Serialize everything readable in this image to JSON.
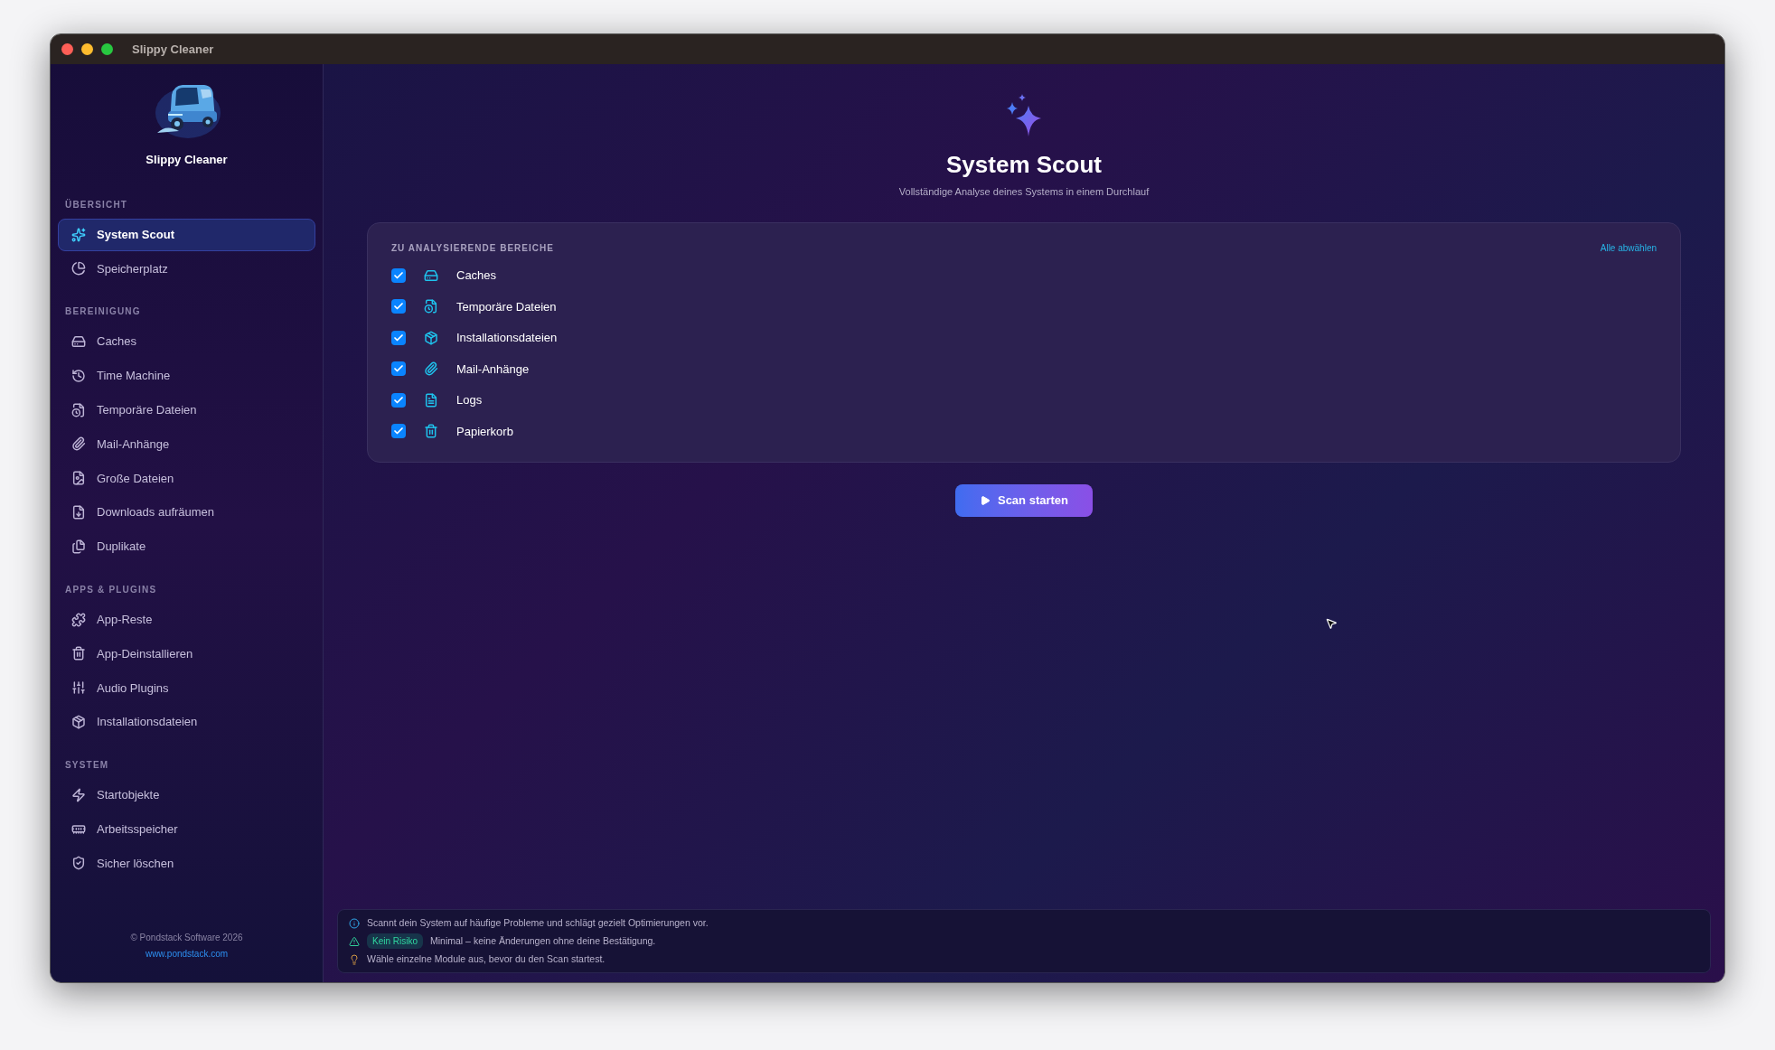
{
  "window": {
    "title": "Slippy Cleaner"
  },
  "sidebar": {
    "app_name": "Slippy Cleaner",
    "sections": [
      {
        "title": "ÜBERSICHT",
        "items": [
          {
            "label": "System Scout",
            "kind": "sparkles",
            "selected": true
          },
          {
            "label": "Speicherplatz",
            "kind": "pie",
            "selected": false
          }
        ]
      },
      {
        "title": "BEREINIGUNG",
        "items": [
          {
            "label": "Caches",
            "kind": "drive",
            "selected": false
          },
          {
            "label": "Time Machine",
            "kind": "history",
            "selected": false
          },
          {
            "label": "Temporäre Dateien",
            "kind": "fileclock",
            "selected": false
          },
          {
            "label": "Mail-Anhänge",
            "kind": "clip",
            "selected": false
          },
          {
            "label": "Große Dateien",
            "kind": "fileimage",
            "selected": false
          },
          {
            "label": "Downloads aufräumen",
            "kind": "filedown",
            "selected": false
          },
          {
            "label": "Duplikate",
            "kind": "files",
            "selected": false
          }
        ]
      },
      {
        "title": "APPS & PLUGINS",
        "items": [
          {
            "label": "App-Reste",
            "kind": "puzzle",
            "selected": false
          },
          {
            "label": "App-Deinstallieren",
            "kind": "trashcircle",
            "selected": false
          },
          {
            "label": "Audio Plugins",
            "kind": "sliders",
            "selected": false
          },
          {
            "label": "Installationsdateien",
            "kind": "package",
            "selected": false
          }
        ]
      },
      {
        "title": "SYSTEM",
        "items": [
          {
            "label": "Startobjekte",
            "kind": "bolt",
            "selected": false
          },
          {
            "label": "Arbeitsspeicher",
            "kind": "memory",
            "selected": false
          },
          {
            "label": "Sicher löschen",
            "kind": "shield",
            "selected": false
          }
        ]
      }
    ],
    "copyright": "© Pondstack Software 2026",
    "link": "www.pondstack.com"
  },
  "main": {
    "title": "System Scout",
    "subtitle": "Vollständige Analyse deines Systems in einem Durchlauf",
    "panel": {
      "heading": "ZU ANALYSIERENDE BEREICHE",
      "deselect_all": "Alle abwählen",
      "areas": [
        {
          "label": "Caches",
          "kind": "drive",
          "checked": true
        },
        {
          "label": "Temporäre Dateien",
          "kind": "fileclock",
          "checked": true
        },
        {
          "label": "Installationsdateien",
          "kind": "package",
          "checked": true
        },
        {
          "label": "Mail-Anhänge",
          "kind": "clip",
          "checked": true
        },
        {
          "label": "Logs",
          "kind": "filetext",
          "checked": true
        },
        {
          "label": "Papierkorb",
          "kind": "trash",
          "checked": true
        }
      ]
    },
    "scan_button": "Scan starten",
    "info": [
      {
        "kind": "info",
        "text": "Scannt dein System auf häufige Probleme und schlägt gezielt Optimierungen vor."
      },
      {
        "kind": "risk",
        "badge": "Kein Risiko",
        "text": "Minimal – keine Änderungen ohne deine Bestätigung."
      },
      {
        "kind": "tip",
        "text": "Wähle einzelne Module aus, bevor du den Scan startest."
      }
    ]
  }
}
